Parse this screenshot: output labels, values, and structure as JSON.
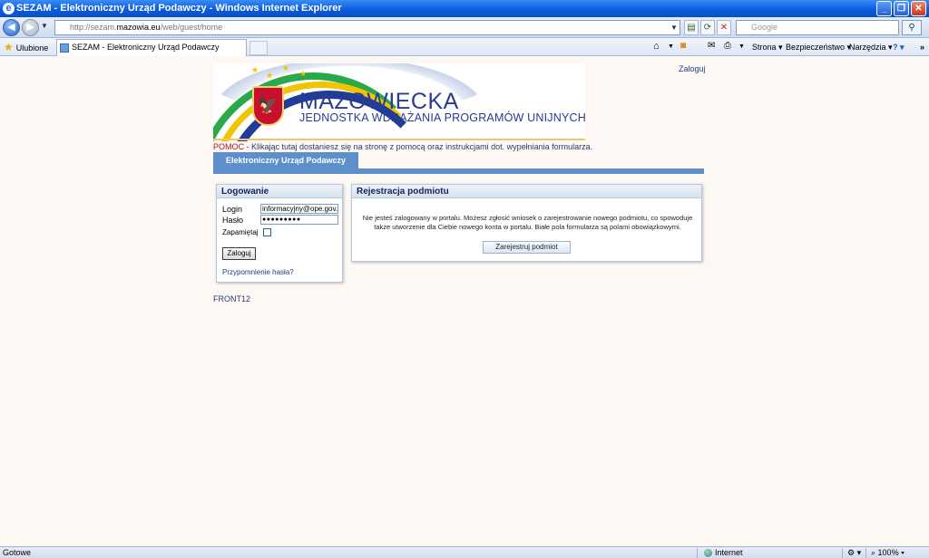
{
  "window": {
    "title": "SEZAM - Elektroniczny Urząd Podawczy - Windows Internet Explorer"
  },
  "address_bar": {
    "url_prefix": "http://sezam.",
    "url_domain": "mazowia.eu",
    "url_path": "/web/guest/home"
  },
  "search": {
    "placeholder": "Google"
  },
  "favorites": {
    "label": "Ulubione"
  },
  "tabs": [
    {
      "label": "SEZAM - Elektroniczny Urząd Podawczy"
    }
  ],
  "command_bar": {
    "page": "Strona",
    "safety": "Bezpieczeństwo",
    "tools": "Narzędzia"
  },
  "page": {
    "login_link": "Zaloguj",
    "banner": {
      "title": "MAZOWIECKA",
      "subtitle": "JEDNOSTKA WDRAŻANIA PROGRAMÓW UNIJNYCH"
    },
    "help": {
      "prefix": "POMOC",
      "text": " - Klikając tutaj dostaniesz się na stronę z pomocą oraz instrukcjami dot. wypełniania formularza."
    },
    "nav_tab": "Elektroniczny Urząd Podawczy",
    "login_panel": {
      "title": "Logowanie",
      "login_label": "Login",
      "login_value": "informacyjny@ope.gov.pl",
      "password_label": "Hasło",
      "password_value": "●●●●●●●●●",
      "remember_label": "Zapamiętaj",
      "login_button": "Zaloguj",
      "forgot_link": "Przypomnienie hasła?"
    },
    "registration_panel": {
      "title": "Rejestracja podmiotu",
      "text": "Nie jesteś zalogowany w portalu. Możesz zgłosić wniosek o zarejestrowanie nowego podmiotu, co spowoduje także utworzenie dla Ciebie nowego konta w portalu. Białe pola formularza są polami obowiązkowymi.",
      "button": "Zarejestruj podmiot"
    },
    "footer_code": "FRONT12"
  },
  "status_bar": {
    "status": "Gotowe",
    "zone": "Internet",
    "zoom": "100%"
  },
  "colors": {
    "ie_blue": "#0859db",
    "nav_blue": "#5d8fcb",
    "brand_navy": "#2a3b91",
    "page_bg": "#fef8f5"
  }
}
